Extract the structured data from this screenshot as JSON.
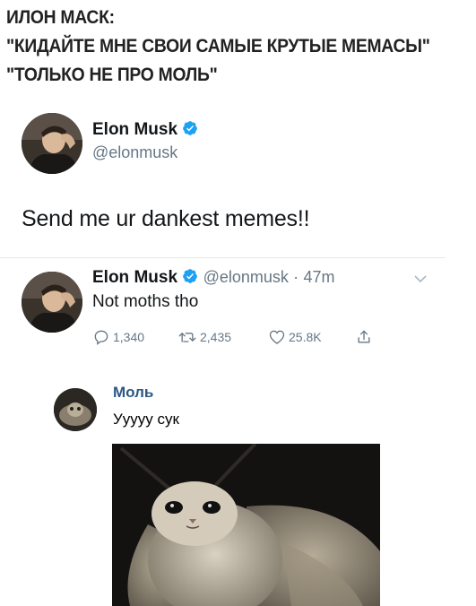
{
  "caption": {
    "lines": [
      "ИЛОН МАСК:",
      "\"КИДАЙТЕ МНЕ СВОИ САМЫЕ КРУТЫЕ МЕМАСЫ\"",
      "\"ТОЛЬКО НЕ ПРО МОЛЬ\""
    ]
  },
  "tweet1": {
    "name": "Elon Musk",
    "handle": "@elonmusk",
    "text": "Send me ur dankest memes!!"
  },
  "tweet2": {
    "name": "Elon Musk",
    "handle": "@elonmusk",
    "separator": "·",
    "time": "47m",
    "text": "Not moths tho",
    "actions": {
      "replies": "1,340",
      "retweets": "2,435",
      "likes": "25.8K"
    }
  },
  "comment": {
    "author": "Моль",
    "text": "Ууууу сук"
  },
  "colors": {
    "verified_blue": "#1da1f2",
    "twitter_gray": "#657786",
    "vk_link": "#2a5885"
  },
  "icons": [
    "verified-badge-icon",
    "chevron-down-icon",
    "reply-icon",
    "retweet-icon",
    "like-icon",
    "share-icon"
  ]
}
